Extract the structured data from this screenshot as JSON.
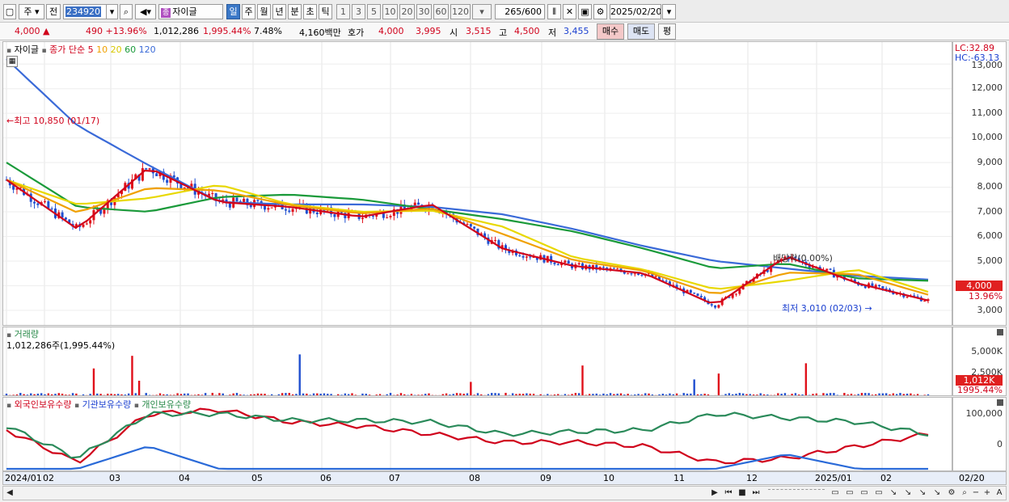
{
  "toolbar": {
    "market": "주",
    "prev_label": "전",
    "code": "234920",
    "name_badge": "종",
    "name": "자이글",
    "periods": [
      "일",
      "주",
      "월",
      "년",
      "분",
      "초",
      "틱"
    ],
    "active_period": "일",
    "intervals": [
      "1",
      "3",
      "5",
      "10",
      "20",
      "30",
      "60",
      "120"
    ],
    "count": "265",
    "count_total": "/600",
    "date": "2025/02/20"
  },
  "quote": {
    "price": "4,000",
    "up_arrow": "▲",
    "change": "490",
    "change_pct": "+13.96%",
    "volume": "1,012,286",
    "volume_ratio": "1,995.44%",
    "turnover": "7.48%",
    "amount": "4,160백만",
    "ask_label": "호가",
    "ask": "4,000",
    "bid": "3,995",
    "open_label": "시",
    "open": "3,515",
    "high_label": "고",
    "high": "4,500",
    "low_label": "저",
    "low": "3,455",
    "buy_button": "매수",
    "sell_button": "매도",
    "avg_button": "평"
  },
  "price_panel": {
    "legend_name": "자이글",
    "legend_ma_label": "종가 단순",
    "ma_periods": [
      "5",
      "10",
      "20",
      "60",
      "120"
    ],
    "ma_colors": [
      "#d0021b",
      "#f0a000",
      "#e8d800",
      "#1a9a3a",
      "#3a6ad8"
    ],
    "high_note": "최고 10,850 (01/17)",
    "low_note": "최저 3,010 (02/03)",
    "event_note": "배당락(0.00%)",
    "lc": "LC:32.89",
    "hc": "HC:-63.13",
    "y_ticks": [
      "13,000",
      "12,000",
      "11,000",
      "10,000",
      "9,000",
      "8,000",
      "7,000",
      "6,000",
      "5,000",
      "4,000",
      "3,000"
    ],
    "current_tag": "4,000",
    "current_pct": "13.96%"
  },
  "volume_panel": {
    "title": "거래량",
    "value_note": "1,012,286주(1,995.44%)",
    "y_ticks": [
      "5,000K",
      "2,500K"
    ],
    "current_tag": "1,012K",
    "current_pct": "1995.44%"
  },
  "holdings_panel": {
    "series": [
      "외국인보유수량",
      "기관보유수량",
      "개인보유수량"
    ],
    "series_colors": [
      "#d0021b",
      "#2a6ad8",
      "#2a8a5a"
    ],
    "y_ticks": [
      "100,000",
      "0"
    ]
  },
  "dates": [
    "2024/01",
    "02",
    "03",
    "04",
    "05",
    "06",
    "07",
    "08",
    "09",
    "10",
    "11",
    "12",
    "2025/01",
    "02"
  ],
  "date_end": "02/20",
  "chart_data": {
    "type": "line",
    "x_range": [
      "2024/01",
      "2025/02/20"
    ],
    "ylim": [
      2800,
      13500
    ],
    "series": [
      {
        "name": "종가 단순 120",
        "values": [
          13200,
          10500,
          8900,
          7400,
          7300,
          7300,
          7200,
          6900,
          6300,
          5600,
          5000,
          4700,
          4400,
          4250
        ]
      },
      {
        "name": "종가 단순 60",
        "values": [
          9000,
          7200,
          7000,
          7600,
          7700,
          7500,
          7100,
          6700,
          6200,
          5500,
          4700,
          4900,
          4300,
          4200
        ]
      },
      {
        "name": "종가 단순 5",
        "values": [
          8300,
          6300,
          8800,
          7400,
          7200,
          6800,
          7300,
          5500,
          4800,
          4500,
          3200,
          5200,
          4100,
          3400
        ]
      }
    ],
    "high": {
      "value": 10850,
      "date": "01/17"
    },
    "low": {
      "value": 3010,
      "date": "02/03"
    },
    "last": 4000
  }
}
